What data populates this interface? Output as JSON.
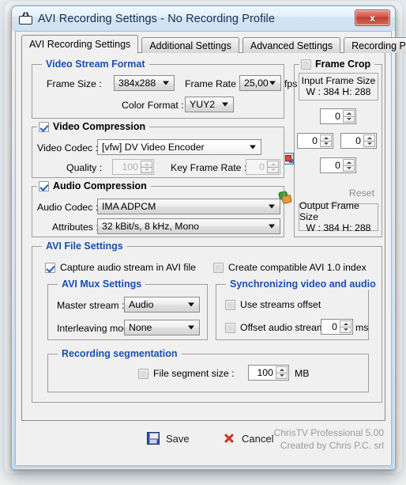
{
  "window": {
    "title": "AVI Recording Settings - No Recording Profile",
    "icon": "tv-icon",
    "close_label": "x"
  },
  "tabs": [
    {
      "label": "AVI Recording Settings",
      "active": true
    },
    {
      "label": "Additional Settings",
      "active": false
    },
    {
      "label": "Advanced Settings",
      "active": false
    },
    {
      "label": "Recording Profiles",
      "active": false
    }
  ],
  "video_stream_format": {
    "title": "Video Stream Format",
    "frame_size_label": "Frame Size :",
    "frame_size_value": "384x288",
    "frame_rate_label": "Frame Rate :",
    "frame_rate_value": "25,00",
    "fps_unit": "fps",
    "color_format_label": "Color Format :",
    "color_format_value": "YUY2",
    "properties_icon": "properties-icon"
  },
  "video_compression": {
    "title": "Video Compression",
    "checked": true,
    "codec_label": "Video Codec :",
    "codec_value": "[vfw] DV Video Encoder",
    "configure_icon": "plugin-icon",
    "quality_label": "Quality :",
    "quality_value": "100",
    "quality_enabled": false,
    "key_frame_rate_label": "Key Frame Rate :",
    "key_frame_rate_value": "0",
    "key_frame_rate_enabled": false
  },
  "audio_compression": {
    "title": "Audio Compression",
    "checked": true,
    "codec_label": "Audio Codec :",
    "codec_value": "IMA ADPCM",
    "attributes_label": "Attributes :",
    "attributes_value": "32 kBit/s, 8 kHz, Mono"
  },
  "frame_crop": {
    "title": "Frame Crop",
    "checked": false,
    "input_frame_size_label": "Input Frame Size",
    "input_frame_size_value": "W : 384   H: 288",
    "crop_top": "0",
    "crop_left": "0",
    "crop_right": "0",
    "crop_bottom": "0",
    "reset_label": "Reset",
    "output_frame_size_label": "Output Frame Size",
    "output_frame_size_value": "W : 384   H: 288"
  },
  "avi_file_settings": {
    "title": "AVI File Settings",
    "capture_audio_label": "Capture audio stream in AVI file",
    "capture_audio_checked": true,
    "compatible_index_label": "Create compatible  AVI 1.0 index",
    "compatible_index_checked": false,
    "mux": {
      "title": "AVI Mux Settings",
      "master_stream_label": "Master stream :",
      "master_stream_value": "Audio",
      "interleaving_label": "Interleaving mode :",
      "interleaving_value": "None"
    },
    "sync": {
      "title": "Synchronizing video and audio",
      "use_offset_label": "Use streams offset",
      "use_offset_checked": false,
      "offset_audio_label": "Offset audio stream :",
      "offset_audio_checked": false,
      "offset_value": "0",
      "offset_unit": "ms"
    },
    "segmentation": {
      "title": "Recording segmentation",
      "file_segment_label": "File segment size :",
      "file_segment_checked": false,
      "file_segment_value": "100",
      "file_segment_unit": "MB"
    }
  },
  "footer": {
    "save_label": "Save",
    "cancel_label": "Cancel",
    "product": "ChrisTV Professional 5.00",
    "author": "Created by Chris P.C. srl"
  },
  "colors": {
    "group_title": "#1a4fb0",
    "accent": "#2f4fb5",
    "cancel": "#d2321a",
    "window_border": "#7ba7cf"
  }
}
